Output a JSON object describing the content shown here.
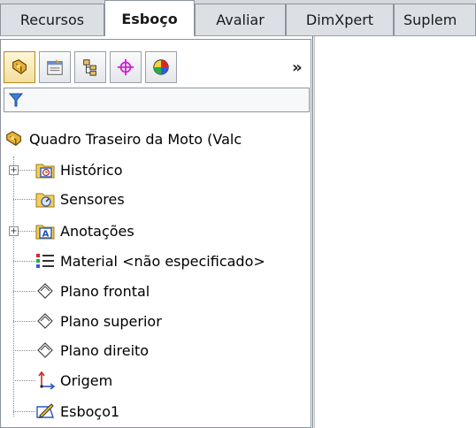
{
  "tabs": [
    {
      "label": "Recursos",
      "active": false
    },
    {
      "label": "Esboço",
      "active": true
    },
    {
      "label": "Avaliar",
      "active": false
    },
    {
      "label": "DimXpert",
      "active": false
    },
    {
      "label": "Suplem",
      "active": false
    }
  ],
  "panel": {
    "toolbar_icons": [
      "featuremanager-icon",
      "propertymanager-icon",
      "configurationmanager-icon",
      "dimxpert-manager-icon",
      "display-manager-icon"
    ],
    "overflow_label": "»"
  },
  "tree": {
    "root": "Quadro Traseiro da Moto  (Valc",
    "items": [
      {
        "label": "Histórico",
        "icon": "history-icon",
        "expandable": true
      },
      {
        "label": "Sensores",
        "icon": "sensors-icon",
        "expandable": false
      },
      {
        "label": "Anotações",
        "icon": "annotations-icon",
        "expandable": true
      },
      {
        "label": "Material <não especificado>",
        "icon": "material-icon",
        "expandable": false
      },
      {
        "label": "Plano frontal",
        "icon": "plane-icon",
        "expandable": false
      },
      {
        "label": "Plano superior",
        "icon": "plane-icon",
        "expandable": false
      },
      {
        "label": "Plano direito",
        "icon": "plane-icon",
        "expandable": false
      },
      {
        "label": "Origem",
        "icon": "origin-icon",
        "expandable": false
      },
      {
        "label": "Esboço1",
        "icon": "sketch-icon",
        "expandable": false
      }
    ]
  },
  "colors": {
    "accent": "#1f4f9e",
    "panel_border": "#8c929a",
    "tab_bg": "#dcdfe3"
  }
}
